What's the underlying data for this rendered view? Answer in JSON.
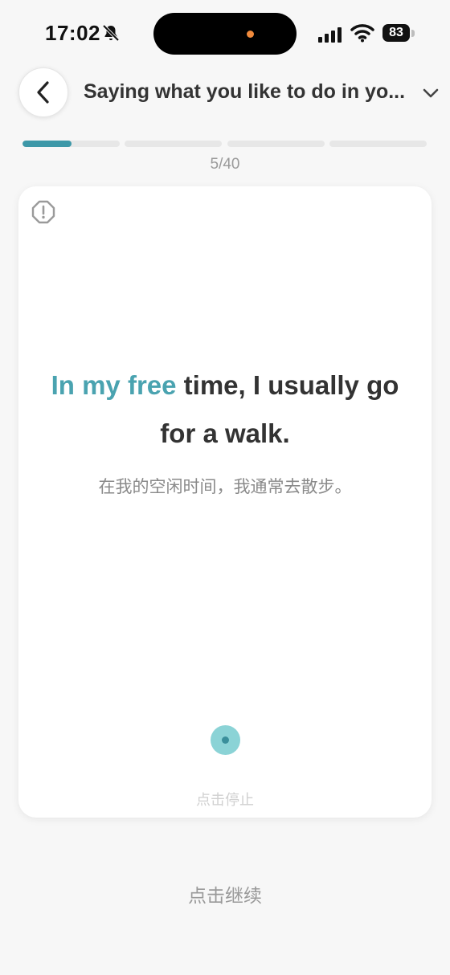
{
  "status_bar": {
    "time": "17:02",
    "battery": "83",
    "icons": [
      "bell-off-icon",
      "signal-icon",
      "wifi-icon",
      "battery-icon"
    ]
  },
  "header": {
    "back_icon": "chevron-left-icon",
    "title": "Saying what you like to do in yo...",
    "dropdown_icon": "chevron-down-icon"
  },
  "progress": {
    "current": 5,
    "total": 40,
    "label": "5/40",
    "segments_fill": [
      0.5,
      0,
      0,
      0
    ],
    "fill_color": "#3d98a8"
  },
  "card": {
    "report_icon": "alert-octagon-icon",
    "sentence_highlight": "In my free",
    "sentence_rest_line1": " time, I usually go",
    "sentence_line2": "for a walk.",
    "highlight_color": "#4aa3b0",
    "translation": "在我的空闲时间，我通常去散步。",
    "stop_label": "点击停止"
  },
  "footer": {
    "continue_label": "点击继续"
  }
}
